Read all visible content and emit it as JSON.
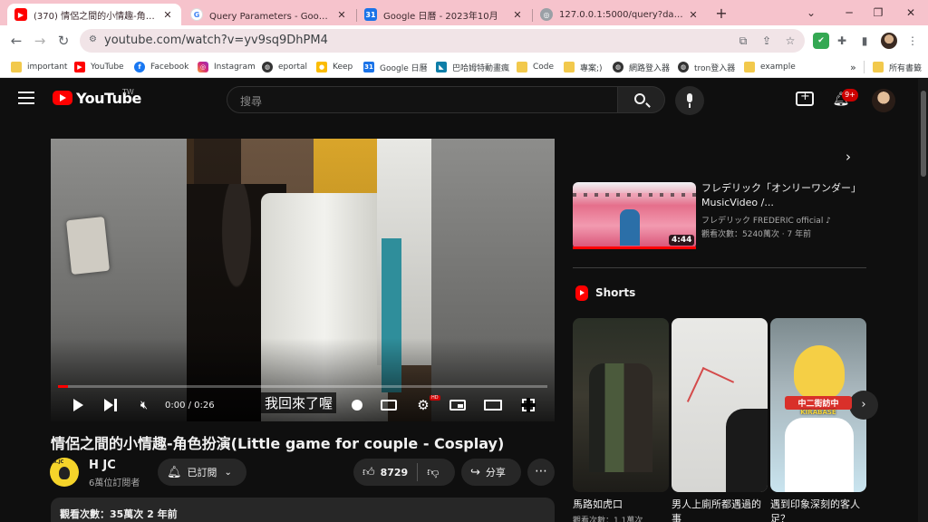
{
  "browser": {
    "tabs": [
      {
        "label": "(370) 情侶之間的小情趣-角色扮演(Little",
        "favicon": "youtube-icon",
        "active": true
      },
      {
        "label": "Query Parameters - Google 搜尋",
        "favicon": "google-icon",
        "active": false
      },
      {
        "label": "Google 日曆 - 2023年10月",
        "favicon": "calendar-icon",
        "active": false
      },
      {
        "label": "127.0.0.1:5000/query?data=haha&w",
        "favicon": "globe-icon",
        "active": false
      }
    ],
    "calendar_day": "31",
    "url": "youtube.com/watch?v=yv9sq9DhPM4",
    "bookmarks": [
      {
        "label": "important",
        "icon": "folder-icon"
      },
      {
        "label": "YouTube",
        "icon": "youtube-icon"
      },
      {
        "label": "Facebook",
        "icon": "facebook-icon"
      },
      {
        "label": "Instagram",
        "icon": "instagram-icon"
      },
      {
        "label": "eportal",
        "icon": "globe-icon"
      },
      {
        "label": "Keep",
        "icon": "keep-icon"
      },
      {
        "label": "Google 日曆",
        "icon": "calendar-icon"
      },
      {
        "label": "巴哈姆特動畫瘋",
        "icon": "bahamut-icon"
      },
      {
        "label": "Code",
        "icon": "folder-icon"
      },
      {
        "label": "專案;)",
        "icon": "folder-icon"
      },
      {
        "label": "網路登入器",
        "icon": "globe-icon"
      },
      {
        "label": "tron登入器",
        "icon": "globe-icon"
      },
      {
        "label": "example",
        "icon": "folder-icon"
      }
    ],
    "overflow_label": "»",
    "all_bookmarks": "所有書籤"
  },
  "youtube": {
    "logo_text": "YouTube",
    "country_code": "TW",
    "search_placeholder": "搜尋",
    "notification_count": "9+"
  },
  "player": {
    "progress": 0.02,
    "time": "0:00 / 0:26",
    "subtitle": "我回來了喔",
    "hd_label": "HD"
  },
  "video": {
    "title": "情侶之間的小情趣-角色扮演(Little game for couple - Cosplay)",
    "channel_name": "H JC",
    "channel_avatar_text": "X.JC",
    "subscribers": "6萬位訂閱者",
    "subscribe_label": "已訂閱",
    "like_count": "8729",
    "share_label": "分享",
    "description_line": "觀看次數：35萬次  2 年前"
  },
  "sidebar": {
    "recommended": {
      "title": "フレデリック「オンリーワンダー」MusicVideo /...",
      "channel": "フレデリック FREDERIC official ♪",
      "meta": "觀看次數：5240萬次 · 7 年前",
      "duration": "4:44"
    },
    "shorts_heading": "Shorts",
    "shorts": [
      {
        "title": "馬路如虎口",
        "views": "觀看次數：1.1萬次"
      },
      {
        "title": "男人上廁所都遇過的事",
        "views": ""
      },
      {
        "title": "遇到印象深刻的客人足？",
        "views": "",
        "caption": "中二街訪中",
        "sub_caption": "KIRABASE"
      }
    ]
  },
  "colors": {
    "tabstrip": "#f6c3cc",
    "yt_background": "#0f0f0f",
    "yt_red": "#ff0000",
    "pill": "#272727"
  }
}
